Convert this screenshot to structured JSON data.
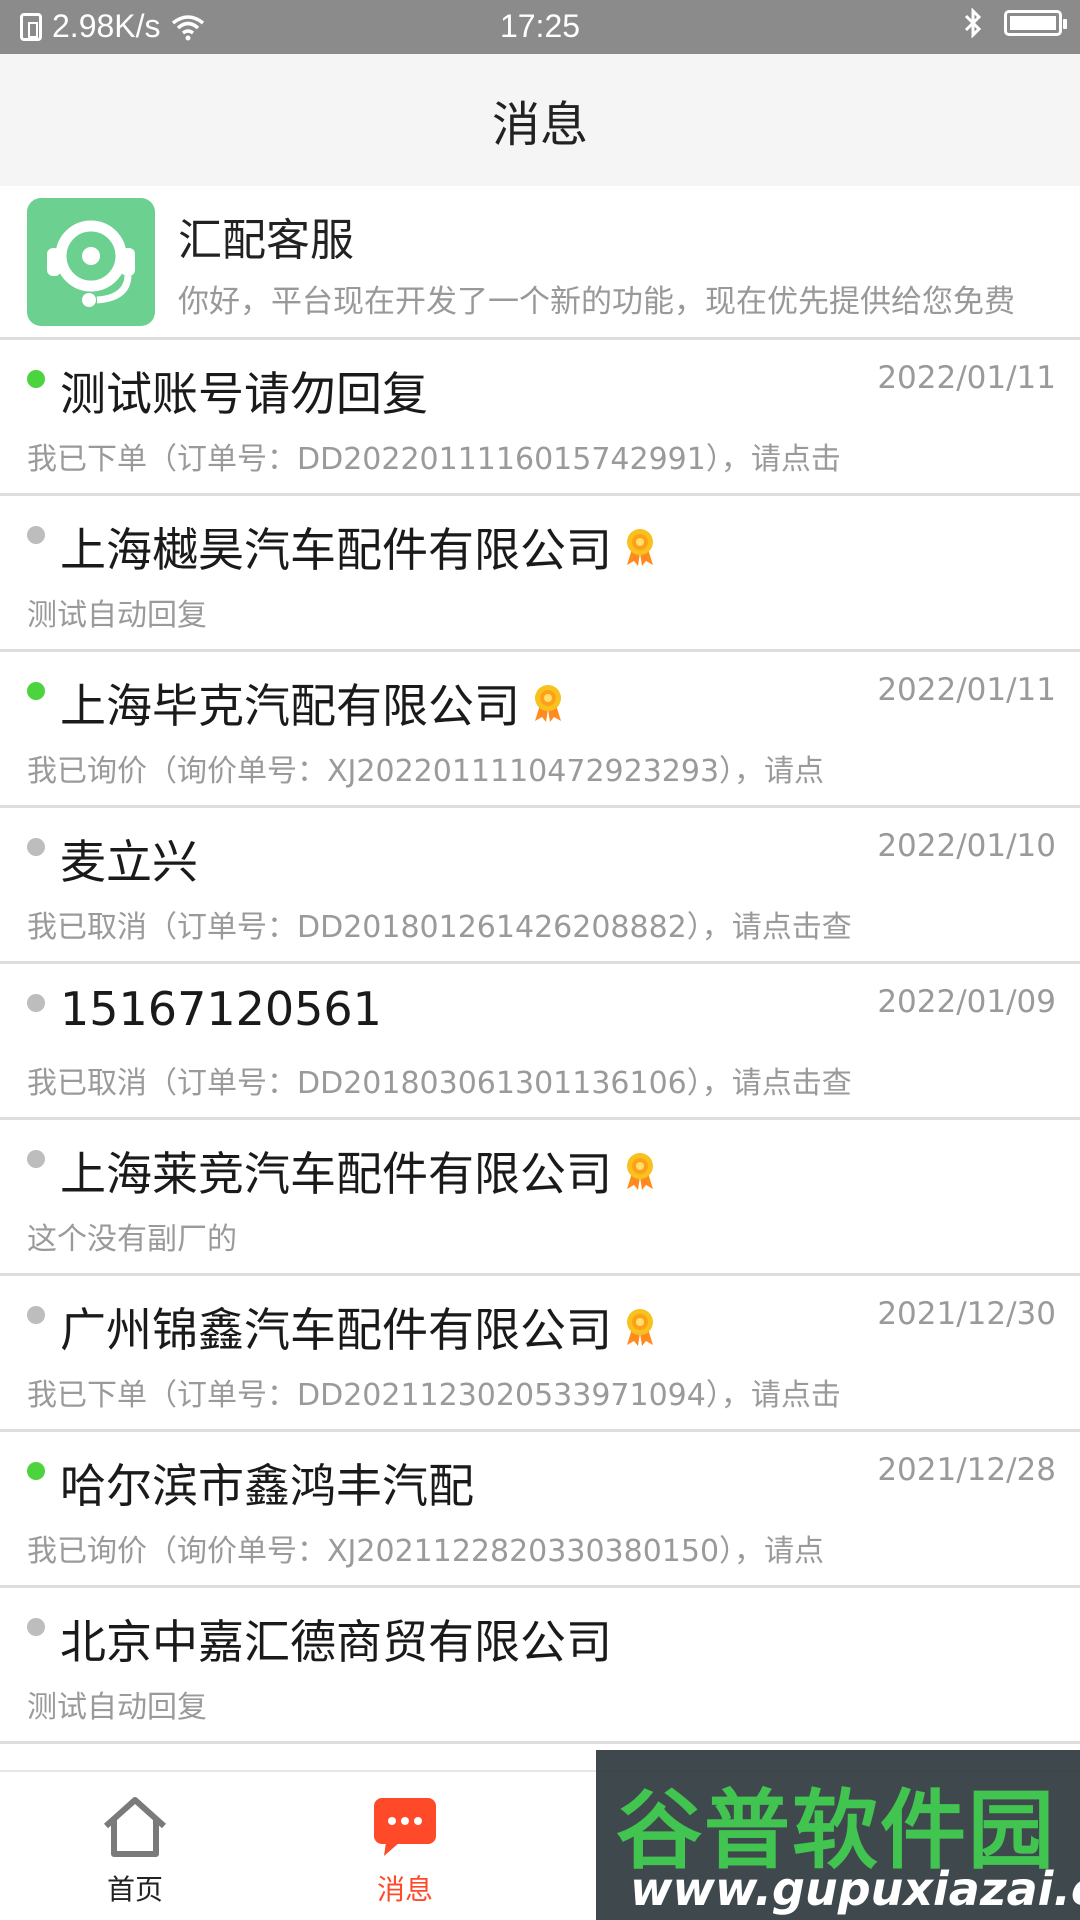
{
  "status_bar": {
    "speed": "2.98K/s",
    "time": "17:25"
  },
  "header": {
    "title": "消息"
  },
  "service": {
    "name": "汇配客服",
    "preview": "你好，平台现在开发了一个新的功能，现在优先提供给您免费"
  },
  "messages": [
    {
      "name": "测试账号请勿回复",
      "date": "2022/01/11",
      "preview": "我已下单（订单号：DD2022011116015742991），请点击",
      "online": true,
      "badge": false
    },
    {
      "name": "上海樾昊汽车配件有限公司",
      "date": "",
      "preview": "测试自动回复",
      "online": false,
      "badge": true
    },
    {
      "name": "上海毕克汽配有限公司",
      "date": "2022/01/11",
      "preview": "我已询价（询价单号：XJ2022011110472923293），请点",
      "online": true,
      "badge": true
    },
    {
      "name": "麦立兴",
      "date": "2022/01/10",
      "preview": "我已取消（订单号：DD2018012614262088​82），请点击查",
      "online": false,
      "badge": false
    },
    {
      "name": "15167120561",
      "date": "2022/01/09",
      "preview": "我已取消（订单号：DD2018030613011361​06），请点击查",
      "online": false,
      "badge": false
    },
    {
      "name": "上海莱竞汽车配件有限公司",
      "date": "",
      "preview": "这个没有副厂的",
      "online": false,
      "badge": true
    },
    {
      "name": "广州锦鑫汽车配件有限公司",
      "date": "2021/12/30",
      "preview": "我已下单（订单号：DD2021123020533971094），请点击",
      "online": false,
      "badge": true
    },
    {
      "name": "哈尔滨市鑫鸿丰汽配",
      "date": "2021/12/28",
      "preview": "我已询价（询价单号：XJ2021122820330380150），请点",
      "online": true,
      "badge": false
    },
    {
      "name": "北京中嘉汇德商贸有限公司",
      "date": "",
      "preview": "测试自动回复",
      "online": false,
      "badge": false
    }
  ],
  "tabs": {
    "home": "首页",
    "messages": "消息"
  },
  "watermark": {
    "line1": "谷普软件园",
    "line2": "www.gupuxiazai.com"
  },
  "colors": {
    "accent": "#ff4a2a",
    "online": "#4cd43e",
    "service_avatar": "#6cd090"
  }
}
